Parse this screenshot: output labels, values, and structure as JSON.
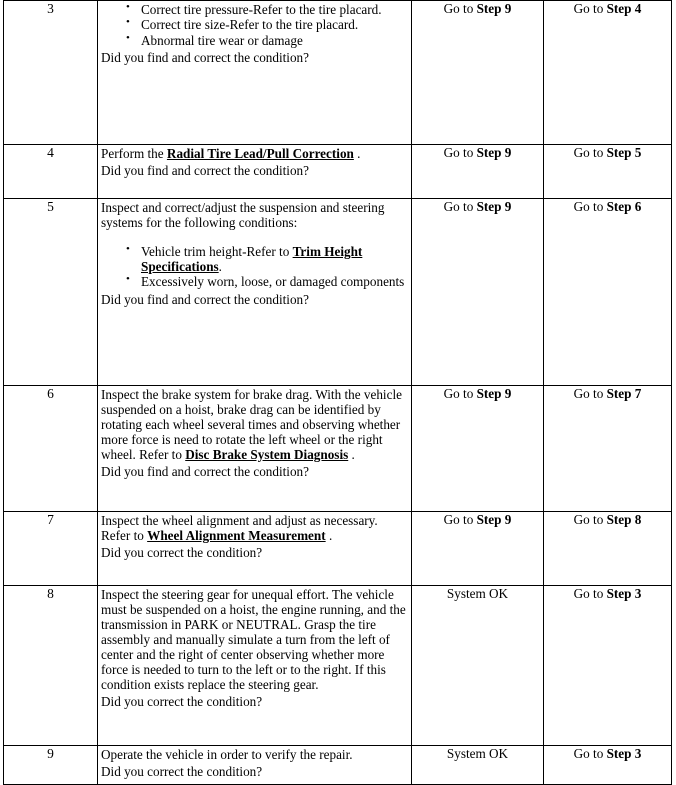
{
  "table": {
    "rows": [
      {
        "step": "3",
        "action": {
          "bullets": [
            "Correct tire pressure-Refer to the tire placard.",
            "Correct tire size-Refer to the tire placard.",
            "Abnormal tire wear or damage"
          ],
          "question": "Did you find and correct the condition?"
        },
        "yes": {
          "prefix": "Go to ",
          "target": "Step 9"
        },
        "no": {
          "prefix": "Go to ",
          "target": "Step 4"
        }
      },
      {
        "step": "4",
        "action": {
          "lead": "Perform the ",
          "ref": "Radial Tire Lead/Pull Correction",
          "trail": " .",
          "question": "Did you find and correct the condition?"
        },
        "yes": {
          "prefix": "Go to ",
          "target": "Step 9"
        },
        "no": {
          "prefix": "Go to ",
          "target": "Step 5"
        }
      },
      {
        "step": "5",
        "action": {
          "intro": "Inspect and correct/adjust the suspension and steering systems for the following conditions:",
          "bullet1_lead": "Vehicle trim height-Refer to ",
          "bullet1_ref": "Trim Height Specifications",
          "bullet1_trail": ".",
          "bullet2": "Excessively worn, loose, or damaged components",
          "question": "Did you find and correct the condition?"
        },
        "yes": {
          "prefix": "Go to ",
          "target": "Step 9"
        },
        "no": {
          "prefix": "Go to ",
          "target": "Step 6"
        }
      },
      {
        "step": "6",
        "action": {
          "lead": "Inspect the brake system for brake drag. With the vehicle suspended on a hoist, brake drag can be identified by rotating each wheel several times and observing whether more force is need to rotate the left wheel or the right wheel. Refer to ",
          "ref": "Disc Brake System Diagnosis",
          "trail": " .",
          "question": "Did you find and correct the condition?"
        },
        "yes": {
          "prefix": "Go to ",
          "target": "Step 9"
        },
        "no": {
          "prefix": "Go to ",
          "target": "Step 7"
        }
      },
      {
        "step": "7",
        "action": {
          "lead": "Inspect the wheel alignment and adjust as necessary. Refer to ",
          "ref": "Wheel Alignment Measurement",
          "trail": " .",
          "question": "Did you correct the condition?"
        },
        "yes": {
          "prefix": "Go to ",
          "target": "Step 9"
        },
        "no": {
          "prefix": "Go to ",
          "target": "Step 8"
        }
      },
      {
        "step": "8",
        "action": {
          "lead": "Inspect the steering gear for unequal effort. The vehicle must be suspended on a hoist, the engine running, and the transmission in PARK or NEUTRAL. Grasp the tire assembly and manually simulate a turn from the left of center and the right of center observing whether more force is needed to turn to the left or to the right. If this condition exists replace the steering gear.",
          "question": "Did you correct the condition?"
        },
        "yes": {
          "prefix": "",
          "target": "System OK"
        },
        "no": {
          "prefix": "Go to ",
          "target": "Step 3"
        }
      },
      {
        "step": "9",
        "action": {
          "lead": "Operate the vehicle in order to verify the repair.",
          "question": "Did you correct the condition?"
        },
        "yes": {
          "prefix": "",
          "target": "System OK"
        },
        "no": {
          "prefix": "Go to ",
          "target": "Step 3"
        }
      }
    ]
  }
}
